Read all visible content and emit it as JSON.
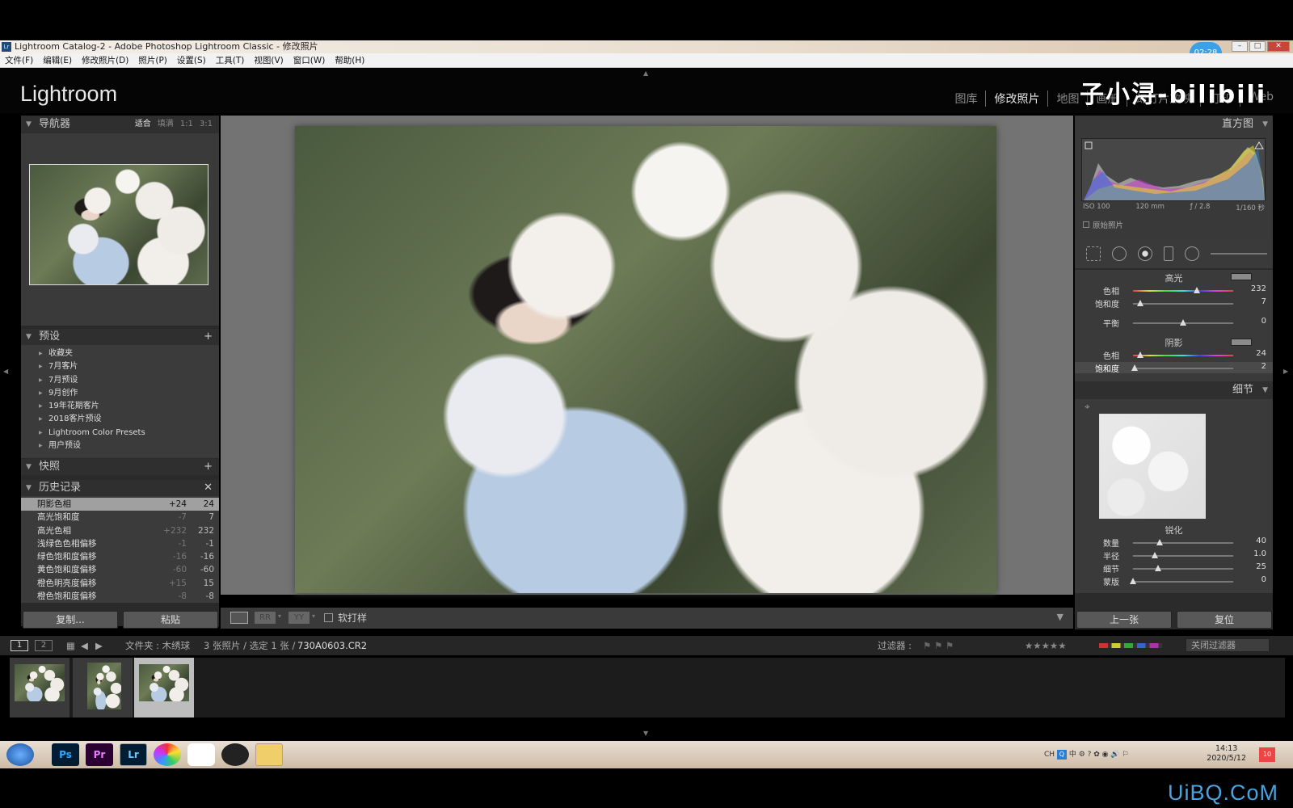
{
  "window": {
    "title": "Lightroom Catalog-2 - Adobe Photoshop Lightroom Classic - 修改照片",
    "icon": "Lr",
    "timer": "02:28"
  },
  "menu": [
    "文件(F)",
    "编辑(E)",
    "修改照片(D)",
    "照片(P)",
    "设置(S)",
    "工具(T)",
    "视图(V)",
    "窗口(W)",
    "帮助(H)"
  ],
  "app": {
    "logo": "Lightroom",
    "modules": [
      "图库",
      "修改照片",
      "地图",
      "画册",
      "幻灯片放映",
      "打印",
      "Web"
    ],
    "active_module": "修改照片",
    "watermark_channel": "子小浔-bilibili"
  },
  "navigator": {
    "title": "导航器",
    "options": [
      "适合",
      "填满",
      "1:1",
      "3:1"
    ],
    "selected": "适合"
  },
  "presets": {
    "title": "预设",
    "items": [
      "收藏夹",
      "7月客片",
      "7月预设",
      "9月创作",
      "19年花期客片",
      "2018客片预设",
      "Lightroom Color Presets",
      "用户预设"
    ]
  },
  "snapshots": {
    "title": "快照"
  },
  "history": {
    "title": "历史记录",
    "items": [
      {
        "name": "阴影色相",
        "change": "+24",
        "value": "24",
        "selected": true
      },
      {
        "name": "高光饱和度",
        "change": "-7",
        "value": "7"
      },
      {
        "name": "高光色相",
        "change": "+232",
        "value": "232"
      },
      {
        "name": "浅绿色色相偏移",
        "change": "-1",
        "value": "-1"
      },
      {
        "name": "绿色饱和度偏移",
        "change": "-16",
        "value": "-16"
      },
      {
        "name": "黄色饱和度偏移",
        "change": "-60",
        "value": "-60"
      },
      {
        "name": "橙色明亮度偏移",
        "change": "+15",
        "value": "15"
      },
      {
        "name": "橙色饱和度偏移",
        "change": "-8",
        "value": "-8"
      }
    ]
  },
  "left_buttons": {
    "copy": "复制...",
    "paste": "粘贴"
  },
  "toolbar": {
    "softproof": "软打样"
  },
  "histogram": {
    "title": "直方图",
    "iso": "ISO 100",
    "focal": "120 mm",
    "aperture": "ƒ / 2.8",
    "shutter": "1/160 秒",
    "original": "原始照片"
  },
  "split_toning": {
    "highlights": {
      "title": "高光",
      "hue_label": "色相",
      "hue": 232,
      "hue_pct": 0.64,
      "sat_label": "饱和度",
      "sat": 7,
      "sat_pct": 0.07
    },
    "balance": {
      "label": "平衡",
      "value": 0,
      "pct": 0.5
    },
    "shadows": {
      "title": "阴影",
      "hue_label": "色相",
      "hue": 24,
      "hue_pct": 0.07,
      "sat_label": "饱和度",
      "sat": 2,
      "sat_pct": 0.02
    }
  },
  "detail": {
    "title": "细节",
    "sharpening": {
      "title": "锐化",
      "rows": [
        {
          "label": "数量",
          "value": "40",
          "pct": 0.27
        },
        {
          "label": "半径",
          "value": "1.0",
          "pct": 0.22
        },
        {
          "label": "细节",
          "value": "25",
          "pct": 0.25
        },
        {
          "label": "蒙版",
          "value": "0",
          "pct": 0.0
        }
      ]
    }
  },
  "right_buttons": {
    "prev": "上一张",
    "reset": "复位"
  },
  "filmstrip": {
    "pages": [
      "1",
      "2"
    ],
    "folder": "文件夹 : 木绣球",
    "count": "3 张照片 / 选定 1 张 /",
    "filename": "730A0603.CR2",
    "filter_label": "过滤器 :",
    "filter_off": "关闭过滤器"
  },
  "taskbar": {
    "apps": [
      "Ps",
      "Pr",
      "Lr"
    ],
    "time": "14:13",
    "date": "2020/5/12",
    "lang": "CH",
    "ime": "中",
    "notif": "10"
  },
  "site_watermark": "UiBQ.CoM"
}
